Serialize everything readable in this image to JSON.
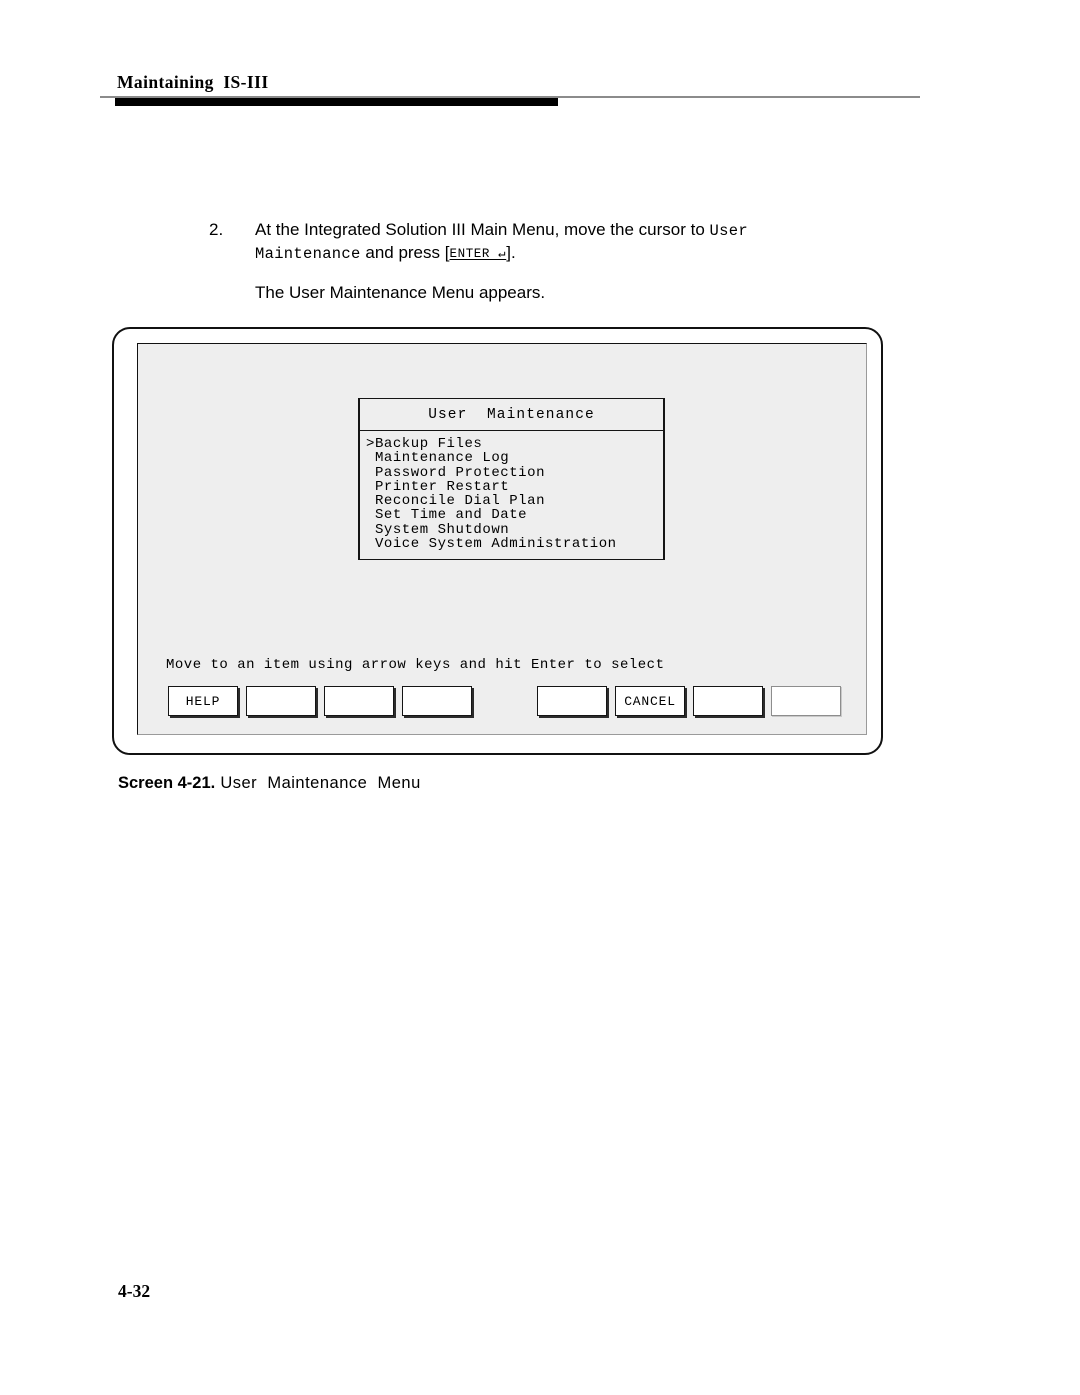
{
  "header": {
    "running_head": "Maintaining  IS-III"
  },
  "step": {
    "number": "2.",
    "text_part1": "At the Integrated Solution III Main Menu, move the cursor to ",
    "mono1": "User",
    "mono2": "Maintenance",
    "text_part2": "and press",
    "bracket_open": "[",
    "keycap": "ENTER ↵",
    "bracket_close": "].",
    "result": "The User Maintenance Menu appears."
  },
  "terminal": {
    "menu": {
      "title": "User  Maintenance",
      "items": [
        ">Backup Files",
        " Maintenance Log",
        " Password Protection",
        " Printer Restart",
        " Reconcile Dial Plan",
        " Set Time and Date",
        " System Shutdown",
        " Voice System Administration"
      ]
    },
    "status_line": "Move to an item using arrow keys and hit Enter to select",
    "function_keys_left": [
      "HELP",
      "",
      "",
      ""
    ],
    "function_keys_right": [
      "",
      "CANCEL",
      "",
      ""
    ]
  },
  "caption": {
    "label": "Screen 4-21.",
    "text": " User  Maintenance  Menu"
  },
  "footer": {
    "page_number": "4-32"
  }
}
